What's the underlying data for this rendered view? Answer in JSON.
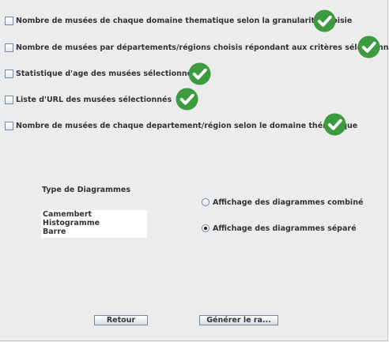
{
  "options": [
    {
      "label": "Nombre de musées de chaque domaine thematique selon la granularité choisie",
      "checked": false
    },
    {
      "label": "Nombre de musées par départements/régions choisis répondant aux critères sélectionnés.",
      "checked": false
    },
    {
      "label": "Statistique d'age des musées sélectionnés",
      "checked": false
    },
    {
      "label": "Liste d'URL des musées sélectionnés",
      "checked": false
    },
    {
      "label": "Nombre de musées de chaque departement/région selon le domaine thématique",
      "checked": false
    }
  ],
  "status_icon": {
    "name": "check-circle-icon",
    "color": "#3d9b3f"
  },
  "chart_type": {
    "label": "Type de Diagrammes",
    "items": [
      "Camembert",
      "Histogramme",
      "Barre"
    ]
  },
  "display_mode": {
    "options": [
      {
        "label": "Affichage des diagrammes combiné",
        "selected": false
      },
      {
        "label": "Affichage des diagrammes séparé",
        "selected": true
      }
    ]
  },
  "buttons": {
    "back": "Retour",
    "generate": "Générer le ra..."
  }
}
